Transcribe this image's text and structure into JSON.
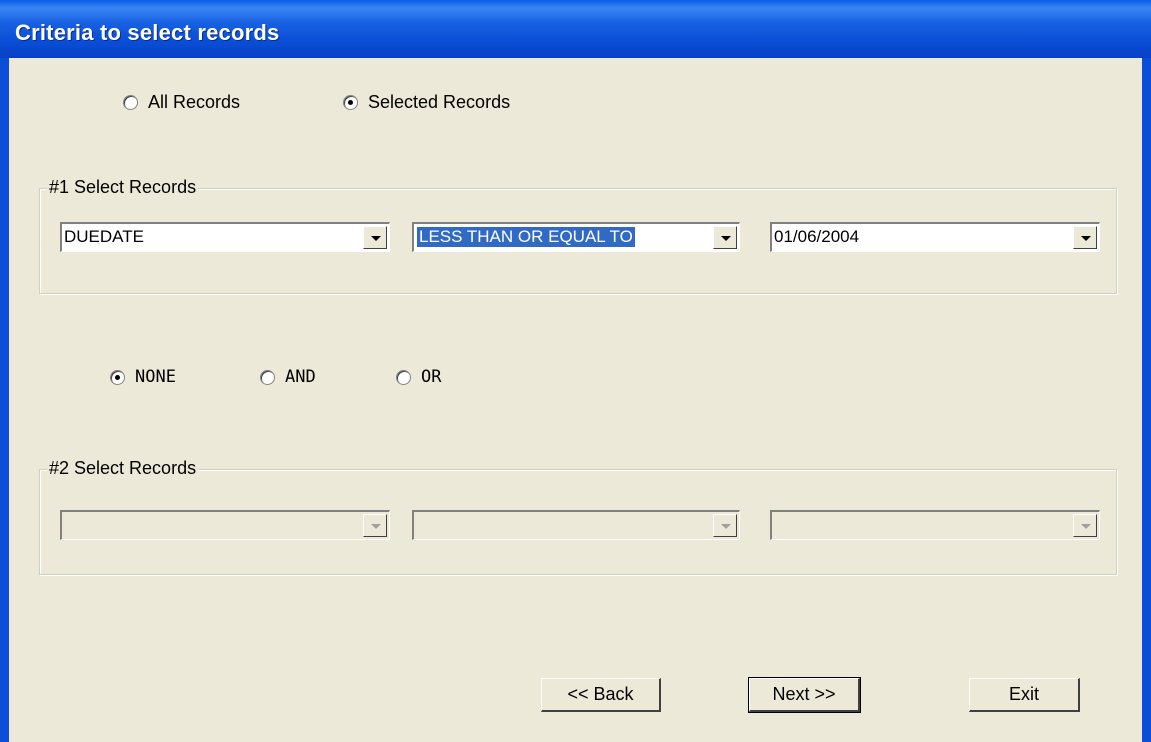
{
  "window": {
    "title": "Criteria to select records"
  },
  "record_scope": {
    "options": [
      {
        "label": "All Records",
        "selected": false
      },
      {
        "label": "Selected Records",
        "selected": true
      }
    ]
  },
  "group1": {
    "legend": "#1 Select Records",
    "field": "DUEDATE",
    "operator": "LESS THAN OR EQUAL TO",
    "value": "01/06/2004"
  },
  "logic": {
    "options": [
      {
        "label": "NONE",
        "selected": true
      },
      {
        "label": "AND",
        "selected": false
      },
      {
        "label": "OR",
        "selected": false
      }
    ]
  },
  "group2": {
    "legend": "#2 Select Records",
    "field": "",
    "operator": "",
    "value": ""
  },
  "buttons": {
    "back": "<< Back",
    "next": "Next >>",
    "exit": "Exit"
  },
  "colors": {
    "titlebar": "#0a4fd7",
    "face": "#ece9d8",
    "selection": "#316ac5"
  }
}
